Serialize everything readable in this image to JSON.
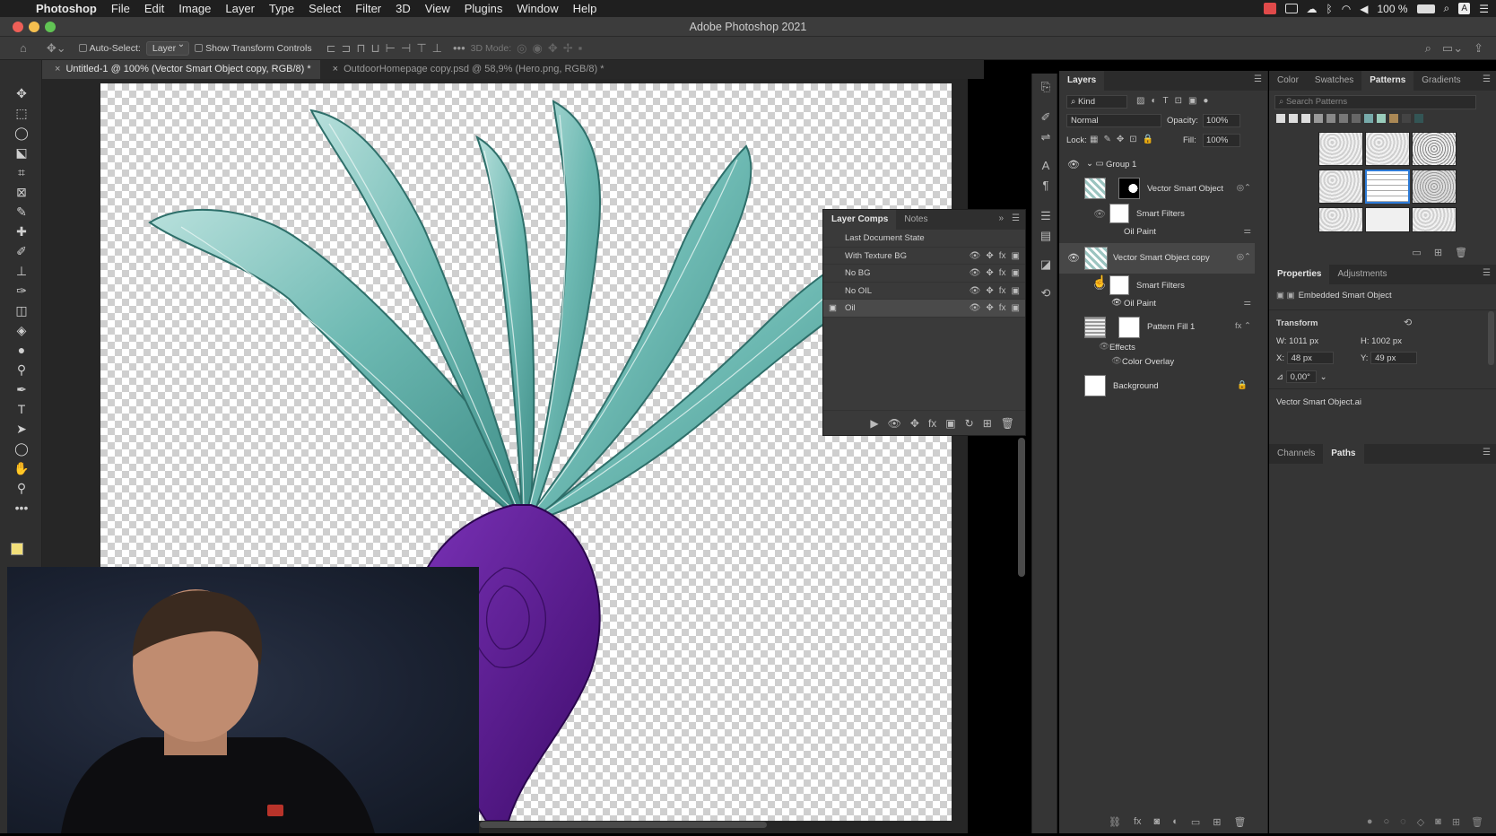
{
  "menubar": {
    "app": "Photoshop",
    "items": [
      "File",
      "Edit",
      "Image",
      "Layer",
      "Type",
      "Select",
      "Filter",
      "3D",
      "View",
      "Plugins",
      "Window",
      "Help"
    ],
    "battery": "100 %"
  },
  "window": {
    "title": "Adobe Photoshop 2021"
  },
  "options": {
    "auto_select_label": "Auto-Select:",
    "auto_select_value": "Layer",
    "transform_label": "Show Transform Controls",
    "mode_label": "3D Mode:"
  },
  "tabs": [
    {
      "label": "Untitled-1 @ 100% (Vector Smart Object copy, RGB/8) *"
    },
    {
      "label": "OutdoorHomepage copy.psd @ 58,9% (Hero.png, RGB/8) *"
    }
  ],
  "layer_comps": {
    "tabs": [
      "Layer Comps",
      "Notes"
    ],
    "rows": [
      {
        "label": "Last Document State"
      },
      {
        "label": "With Texture BG"
      },
      {
        "label": "No BG"
      },
      {
        "label": "No OIL"
      },
      {
        "label": "Oil"
      }
    ]
  },
  "layers": {
    "title": "Layers",
    "kind": "Kind",
    "blend": "Normal",
    "opacity_label": "Opacity:",
    "opacity": "100%",
    "lock_label": "Lock:",
    "fill_label": "Fill:",
    "fill": "100%",
    "group": "Group 1",
    "vso": "Vector Smart Object",
    "smart_filters": "Smart Filters",
    "oil_paint": "Oil Paint",
    "vso_copy": "Vector Smart Object copy",
    "smart_filters2": "Smart Filters",
    "oil_paint2": "Oil Paint",
    "pattern_fill": "Pattern Fill 1",
    "effects": "Effects",
    "color_overlay": "Color Overlay",
    "background": "Background"
  },
  "patterns": {
    "tabs": [
      "Color",
      "Swatches",
      "Patterns",
      "Gradients"
    ],
    "search_placeholder": "Search Patterns"
  },
  "properties": {
    "tabs": [
      "Properties",
      "Adjustments"
    ],
    "type": "Embedded Smart Object",
    "transform_label": "Transform",
    "w": "1011 px",
    "h": "1002 px",
    "x": "48 px",
    "y": "49 px",
    "angle": "0,00°",
    "file": "Vector Smart Object.ai",
    "w_label": "W:",
    "h_label": "H:",
    "x_label": "X:",
    "y_label": "Y:"
  },
  "paths": {
    "tabs": [
      "Channels",
      "Paths"
    ]
  },
  "colors": {
    "accent": "#2d7bd8",
    "teal": "#7cc3bd",
    "purple": "#5a1a8c"
  }
}
